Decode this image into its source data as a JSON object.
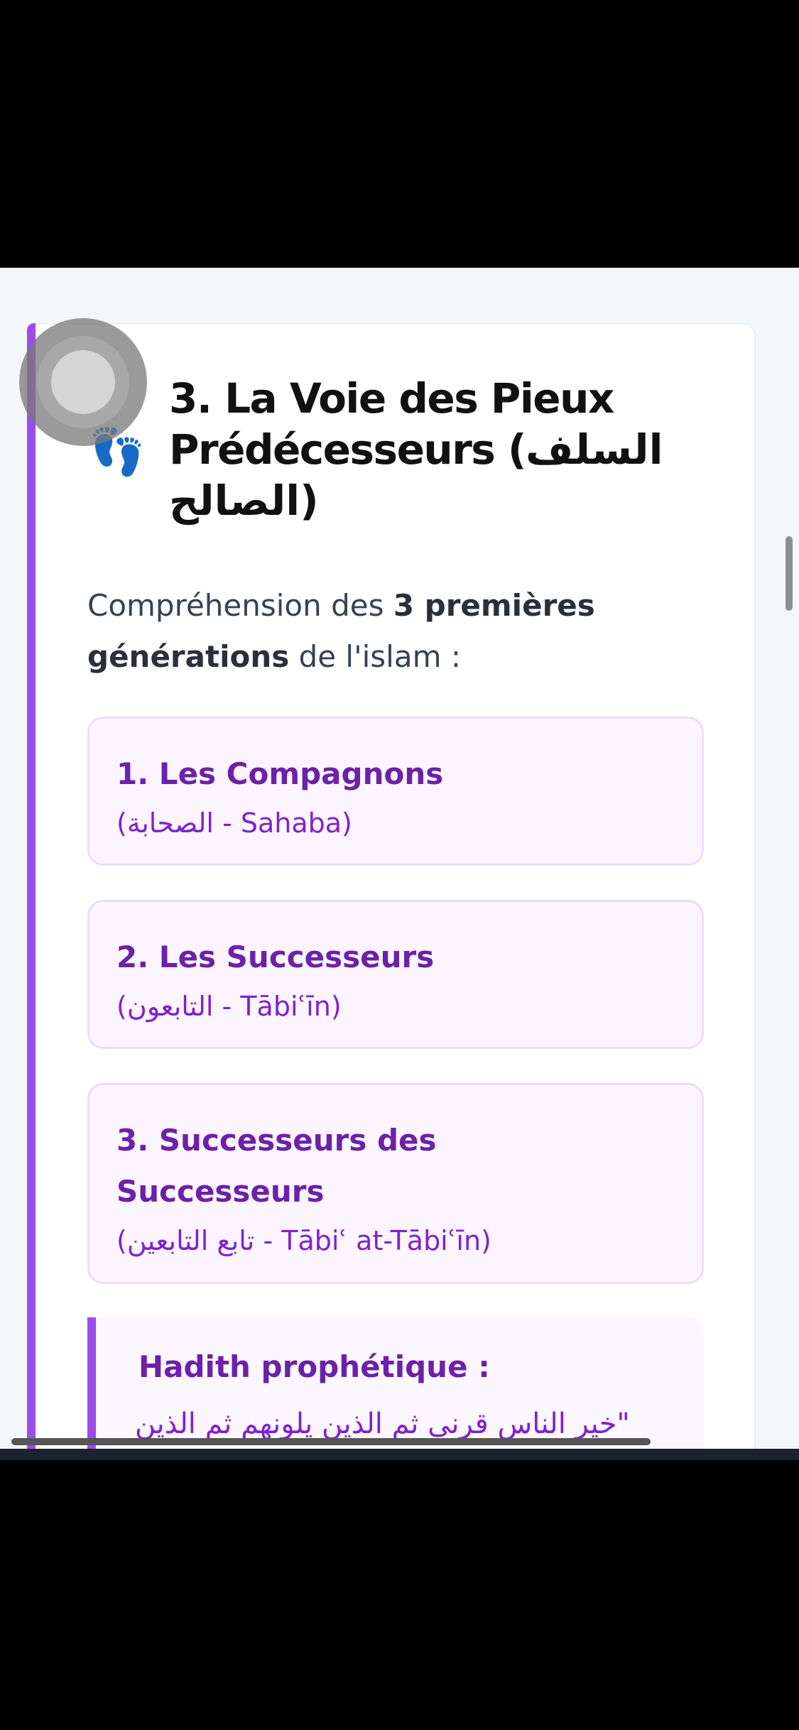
{
  "section": {
    "icon": "footprints-icon",
    "title": "3. La Voie des Pieux Prédécesseurs (السلف الصالح)",
    "intro_prefix": "Compréhension des ",
    "intro_bold1": "3 premières générations",
    "intro_suffix": " de l'islam :"
  },
  "generations": [
    {
      "title": "1. Les Compagnons",
      "subtitle": "(الصحابة - Sahaba)"
    },
    {
      "title": "2. Les Successeurs",
      "subtitle": "(التابعون - Tābiʿīn)"
    },
    {
      "title": "3. Successeurs des Successeurs",
      "subtitle": "(تابع التابعين - Tābiʿ at-Tābiʿīn)"
    }
  ],
  "hadith": {
    "title": "Hadith prophétique :",
    "text": "\"خير الناس قرني ثم الذين يلونهم ثم الذين"
  },
  "colors": {
    "accent": "#9b4dea",
    "title_purple": "#6b21a8",
    "box_bg": "#fcf5ff",
    "box_border": "#ecdcfb"
  }
}
